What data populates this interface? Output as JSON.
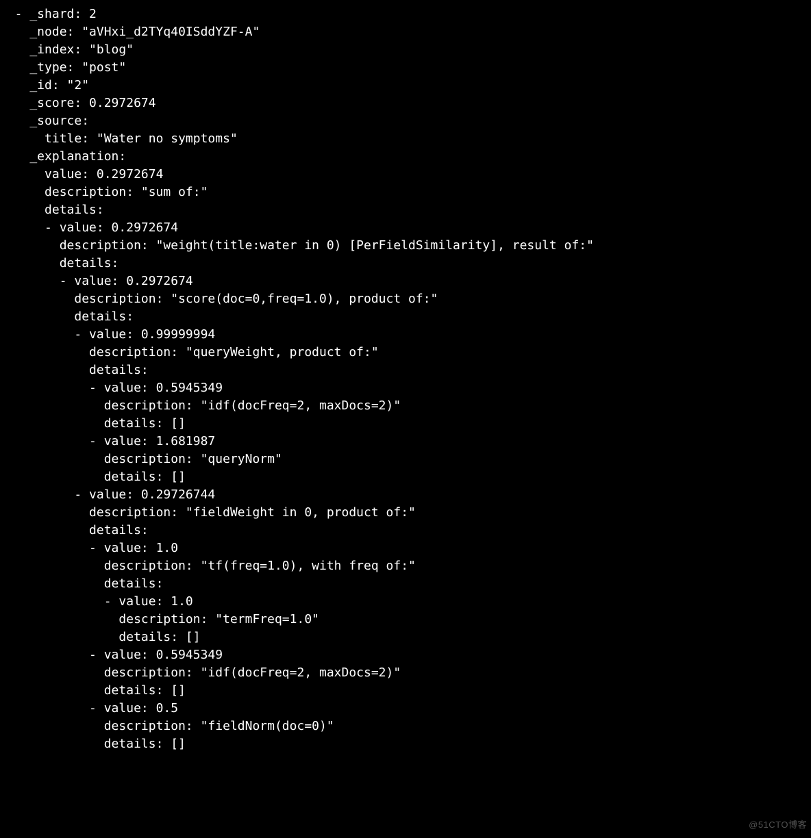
{
  "watermark": "@51CTO博客",
  "lines": [
    "  - _shard: 2",
    "    _node: \"aVHxi_d2TYq40ISddYZF-A\"",
    "    _index: \"blog\"",
    "    _type: \"post\"",
    "    _id: \"2\"",
    "    _score: 0.2972674",
    "    _source:",
    "      title: \"Water no symptoms\"",
    "    _explanation:",
    "      value: 0.2972674",
    "      description: \"sum of:\"",
    "      details:",
    "      - value: 0.2972674",
    "        description: \"weight(title:water in 0) [PerFieldSimilarity], result of:\"",
    "        details:",
    "        - value: 0.2972674",
    "          description: \"score(doc=0,freq=1.0), product of:\"",
    "          details:",
    "          - value: 0.99999994",
    "            description: \"queryWeight, product of:\"",
    "            details:",
    "            - value: 0.5945349",
    "              description: \"idf(docFreq=2, maxDocs=2)\"",
    "              details: []",
    "            - value: 1.681987",
    "              description: \"queryNorm\"",
    "              details: []",
    "          - value: 0.29726744",
    "            description: \"fieldWeight in 0, product of:\"",
    "            details:",
    "            - value: 1.0",
    "              description: \"tf(freq=1.0), with freq of:\"",
    "              details:",
    "              - value: 1.0",
    "                description: \"termFreq=1.0\"",
    "                details: []",
    "            - value: 0.5945349",
    "              description: \"idf(docFreq=2, maxDocs=2)\"",
    "              details: []",
    "            - value: 0.5",
    "              description: \"fieldNorm(doc=0)\"",
    "              details: []"
  ],
  "doc": {
    "_shard": 2,
    "_node": "aVHxi_d2TYq40ISddYZF-A",
    "_index": "blog",
    "_type": "post",
    "_id": "2",
    "_score": 0.2972674,
    "_source": {
      "title": "Water no symptoms"
    },
    "_explanation": {
      "value": 0.2972674,
      "description": "sum of:",
      "details": [
        {
          "value": 0.2972674,
          "description": "weight(title:water in 0) [PerFieldSimilarity], result of:",
          "details": [
            {
              "value": 0.2972674,
              "description": "score(doc=0,freq=1.0), product of:",
              "details": [
                {
                  "value": 0.99999994,
                  "description": "queryWeight, product of:",
                  "details": [
                    {
                      "value": 0.5945349,
                      "description": "idf(docFreq=2, maxDocs=2)",
                      "details": []
                    },
                    {
                      "value": 1.681987,
                      "description": "queryNorm",
                      "details": []
                    }
                  ]
                },
                {
                  "value": 0.29726744,
                  "description": "fieldWeight in 0, product of:",
                  "details": [
                    {
                      "value": 1.0,
                      "description": "tf(freq=1.0), with freq of:",
                      "details": [
                        {
                          "value": 1.0,
                          "description": "termFreq=1.0",
                          "details": []
                        }
                      ]
                    },
                    {
                      "value": 0.5945349,
                      "description": "idf(docFreq=2, maxDocs=2)",
                      "details": []
                    },
                    {
                      "value": 0.5,
                      "description": "fieldNorm(doc=0)",
                      "details": []
                    }
                  ]
                }
              ]
            }
          ]
        }
      ]
    }
  }
}
